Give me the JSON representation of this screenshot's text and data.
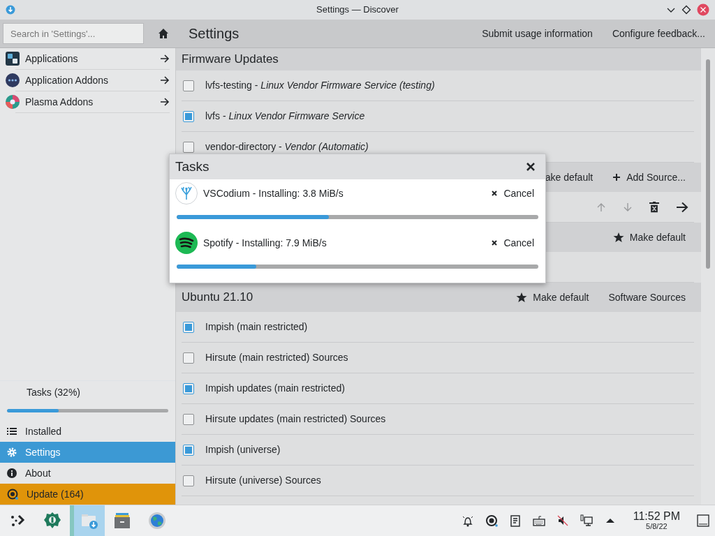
{
  "window": {
    "title": "Settings — Discover"
  },
  "search": {
    "placeholder": "Search in 'Settings'..."
  },
  "page_title": "Settings",
  "toolbar_actions": [
    "Submit usage information",
    "Configure feedback..."
  ],
  "categories": [
    {
      "label": "Applications"
    },
    {
      "label": "Application Addons"
    },
    {
      "label": "Plasma Addons"
    }
  ],
  "tasks_summary": {
    "label": "Tasks (32%)",
    "level": 0.32
  },
  "nav": [
    {
      "label": "Installed",
      "selected": false,
      "kind": "plain"
    },
    {
      "label": "Settings",
      "selected": true,
      "kind": "plain"
    },
    {
      "label": "About",
      "selected": false,
      "kind": "plain"
    },
    {
      "label": "Update (164)",
      "selected": false,
      "kind": "attention"
    }
  ],
  "sections": [
    {
      "title": "Firmware Updates",
      "rows": [
        {
          "kind": "checkbox",
          "name": "lvfs-testing - *Linux Vendor Firmware Service (testing)*",
          "checked": false
        },
        {
          "kind": "checkbox",
          "name": "lvfs - *Linux Vendor Firmware Service*",
          "checked": true
        },
        {
          "kind": "checkbox",
          "name": "vendor-directory - *Vendor (Automatic)*",
          "checked": false
        }
      ]
    },
    {
      "actions": [
        {
          "kind": "plain",
          "label": "ake default"
        },
        {
          "kind": "add",
          "label": "Add Source..."
        }
      ],
      "rows": [
        {
          "kind": "tools",
          "up_disabled": true,
          "down_disabled": true
        }
      ]
    },
    {
      "actions": [
        {
          "kind": "star",
          "label": "Make default"
        }
      ]
    },
    {
      "title": "Ubuntu 21.10",
      "actions": [
        {
          "kind": "star",
          "label": "Make default"
        },
        {
          "kind": "plain",
          "label": "Software Sources"
        }
      ],
      "rows": [
        {
          "kind": "checkbox",
          "name": "Impish (main restricted)",
          "checked": true
        },
        {
          "kind": "checkbox",
          "name": "Hirsute (main restricted) Sources",
          "checked": false
        },
        {
          "kind": "checkbox",
          "name": "Impish updates (main restricted)",
          "checked": true
        },
        {
          "kind": "checkbox",
          "name": "Hirsute updates (main restricted) Sources",
          "checked": false
        },
        {
          "kind": "checkbox",
          "name": "Impish (universe)",
          "checked": true
        },
        {
          "kind": "checkbox",
          "name": "Hirsute (universe) Sources",
          "checked": false
        }
      ]
    }
  ],
  "dialog": {
    "title": "Tasks",
    "items": [
      {
        "text": "VSCodium - Installing: 3.8 MiB/s",
        "cancel": "Cancel",
        "level": 0.42
      },
      {
        "text": "Spotify - Installing: 7.9 MiB/s",
        "cancel": "Cancel",
        "level": 0.22
      }
    ]
  },
  "taskbar": [
    {
      "active": false
    },
    {
      "active": false
    },
    {
      "active": true
    },
    {
      "active": false
    },
    {
      "active": false
    }
  ],
  "clock": {
    "time": "11:52 PM",
    "date": "5/8/22"
  }
}
